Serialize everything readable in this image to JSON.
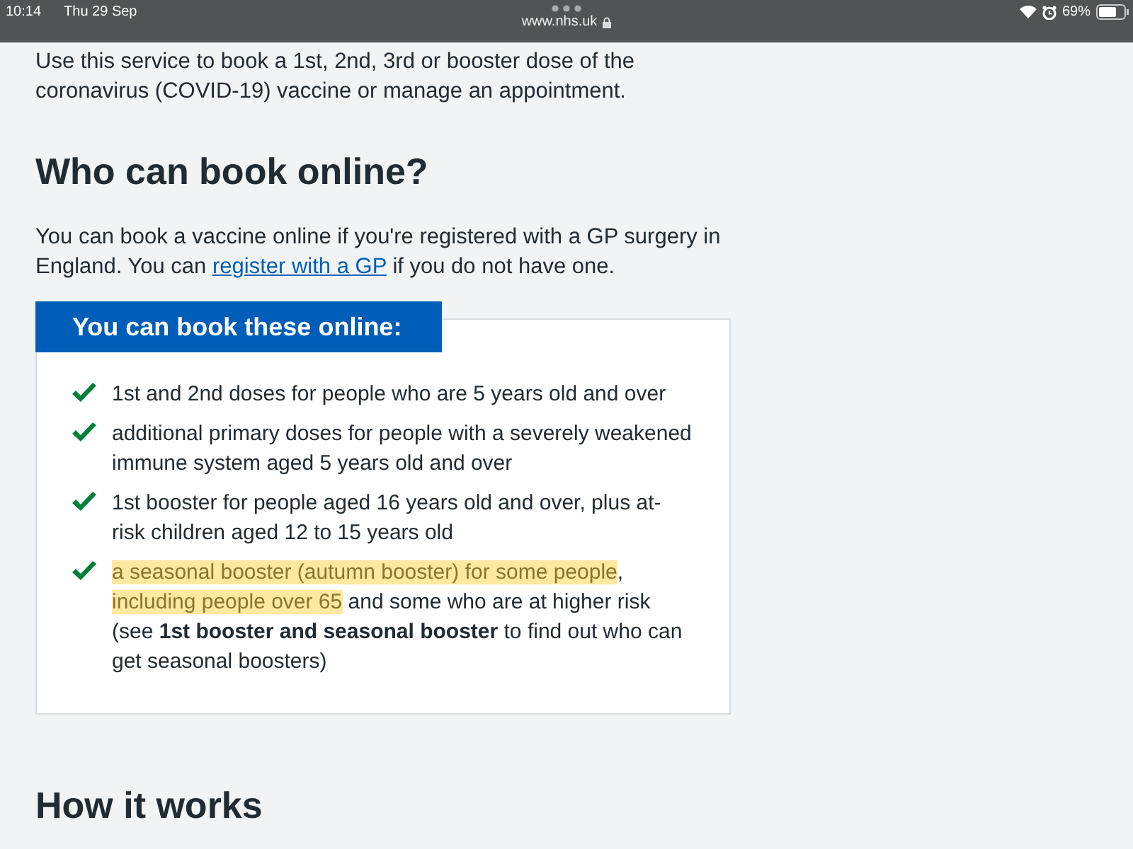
{
  "status_bar": {
    "time": "10:14",
    "date": "Thu 29 Sep",
    "url": "www.nhs.uk",
    "battery": "69%"
  },
  "intro": "Use this service to book a 1st, 2nd, 3rd or booster dose of the coronavirus (COVID-19) vaccine or manage an appointment.",
  "sections": [
    {
      "heading": "Who can book online?",
      "paragraph": [
        {
          "text": "You can book a vaccine online if you're registered with a GP surgery in England. You can ",
          "kind": "text"
        },
        {
          "text": "register with a GP",
          "kind": "link"
        },
        {
          "text": " if you do not have one.",
          "kind": "text"
        }
      ]
    }
  ],
  "card": {
    "label": "You can book these online:",
    "items": [
      {
        "segments": [
          {
            "text": "1st and 2nd doses for people who are 5 years old and over",
            "highlighted": false
          }
        ]
      },
      {
        "segments": [
          {
            "text": "additional primary doses for people with a severely weakened immune system aged 5 years old and over",
            "highlighted": false
          }
        ]
      },
      {
        "segments": [
          {
            "text": "1st booster for people aged 16 years old and over, plus at-risk children aged 12 to 15 years old",
            "highlighted": false
          }
        ]
      },
      {
        "segments": [
          {
            "text": "a seasonal booster (autumn booster) for some people",
            "highlighted": true
          },
          {
            "text": ", ",
            "highlighted": false
          },
          {
            "text": "including people over 65",
            "highlighted": true
          },
          {
            "text": " and some who are at higher risk (see **1st booster and seasonal booster** to find out who can get seasonal boosters)",
            "highlighted": false
          }
        ]
      }
    ]
  },
  "next_heading": "How it works"
}
